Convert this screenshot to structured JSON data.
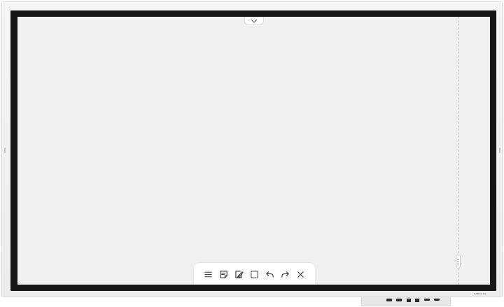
{
  "device": {
    "brand": "SAMSUNG"
  },
  "screen": {
    "collapse_tab_icon": "chevron-down-icon",
    "side_handle_icon": "drag-handle-icon"
  },
  "toolbar": {
    "items": [
      {
        "name": "menu",
        "icon": "menu-icon"
      },
      {
        "name": "sticky-note",
        "icon": "sticky-note-icon"
      },
      {
        "name": "import-document",
        "icon": "document-pen-icon"
      },
      {
        "name": "select",
        "icon": "selection-icon"
      },
      {
        "name": "undo",
        "icon": "undo-icon"
      },
      {
        "name": "redo",
        "icon": "redo-icon"
      },
      {
        "name": "close",
        "icon": "close-icon"
      }
    ]
  },
  "port_panel": {
    "ports": [
      {
        "icon": "hdmi-port-icon"
      },
      {
        "icon": "hdmi-port-icon"
      },
      {
        "icon": "usb-port-icon"
      },
      {
        "icon": "usb-port-icon"
      },
      {
        "icon": "usb-c-port-icon"
      },
      {
        "icon": "usb-c-port-icon"
      }
    ]
  },
  "colors": {
    "bezel": "#161616",
    "canvas": "#f0f0f0",
    "toolbar": "#ffffff",
    "icon": "#3a3a3a"
  }
}
